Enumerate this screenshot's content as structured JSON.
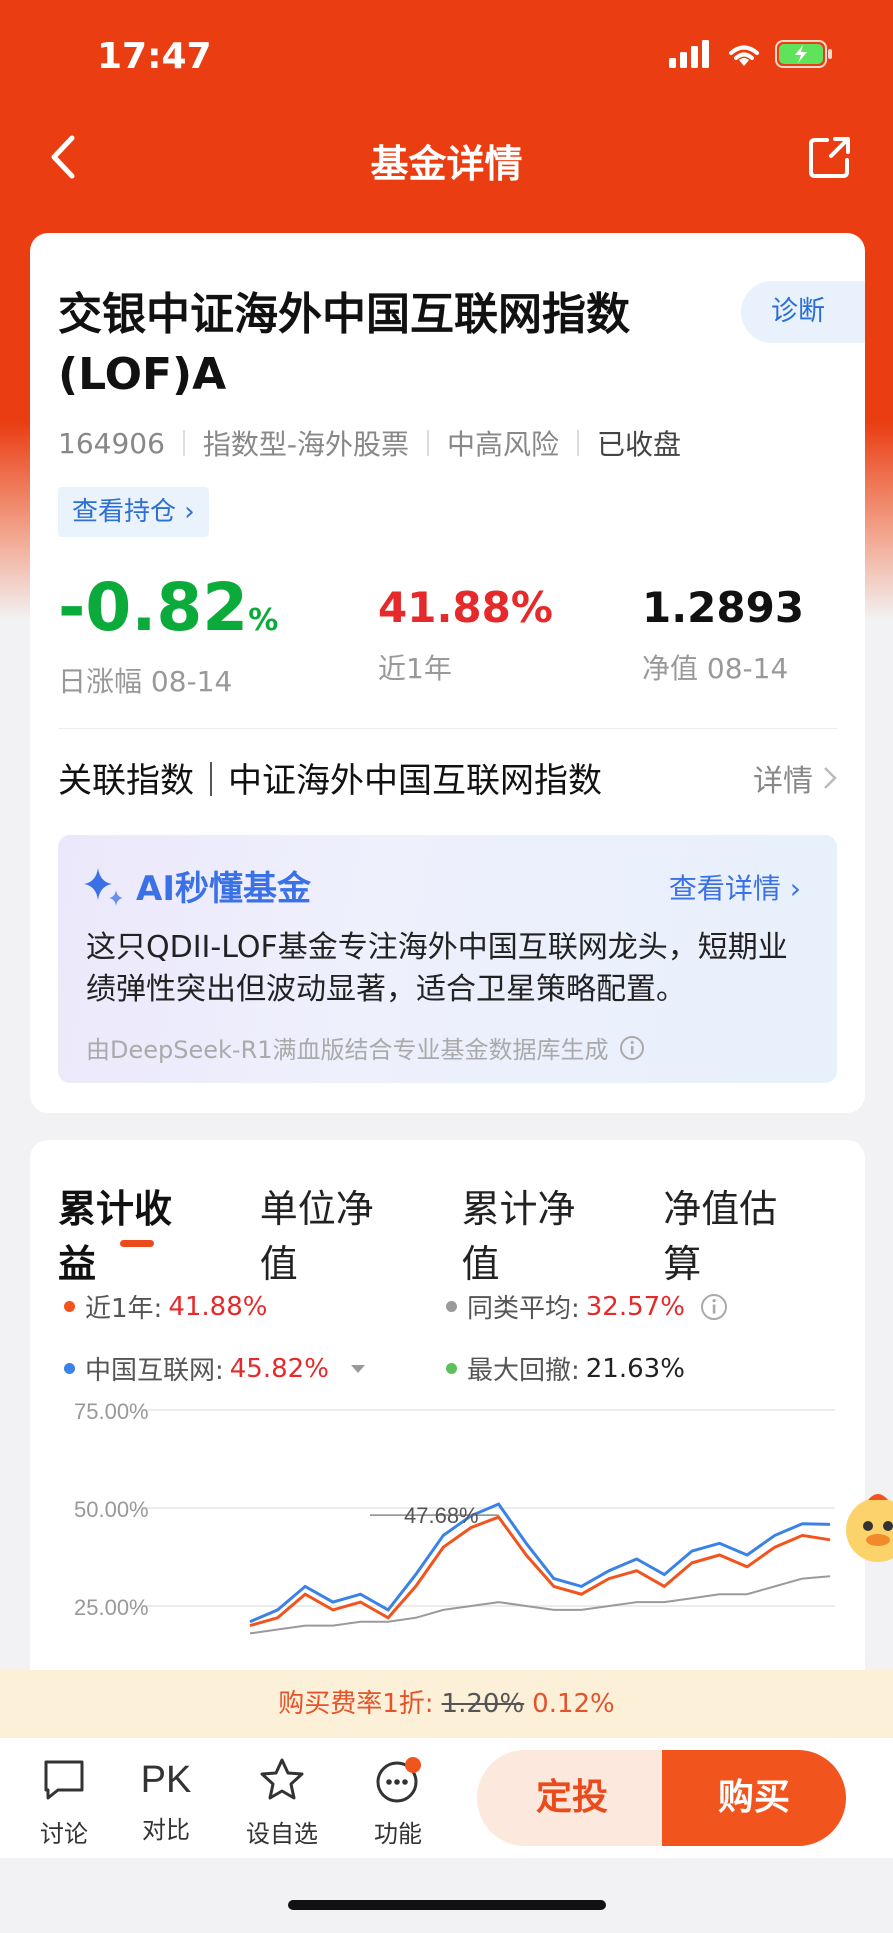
{
  "status": {
    "time": "17:47"
  },
  "nav": {
    "title": "基金详情"
  },
  "fund": {
    "name_line1": "交银中证海外中国互联网指数",
    "name_line2": "(LOF)A",
    "diagnose_label": "诊断",
    "code": "164906",
    "type": "指数型-海外股票",
    "risk": "中高风险",
    "market_status": "已收盘",
    "holdings_label": "查看持仓 ›"
  },
  "stats": {
    "daily_change": "-0.82",
    "daily_change_unit": "%",
    "daily_label": "日涨幅 08-14",
    "one_year": "41.88%",
    "one_year_label": "近1年",
    "nav": "1.2893",
    "nav_label": "净值 08-14"
  },
  "index_row": {
    "label": "关联指数｜中证海外中国互联网指数",
    "more": "详情"
  },
  "ai": {
    "title": "AI秒懂基金",
    "more": "查看详情",
    "text": "这只QDII-LOF基金专注海外中国互联网龙头，短期业绩弹性突出但波动显著，适合卫星策略配置。",
    "footer": "由DeepSeek-R1满血版结合专业基金数据库生成"
  },
  "tabs": [
    "累计收益",
    "单位净值",
    "累计净值",
    "净值估算"
  ],
  "legend": {
    "l1_name": "近1年:",
    "l1_value": "41.88%",
    "l2_name": "同类平均:",
    "l2_value": "32.57%",
    "l3_name": "中国互联网:",
    "l3_value": "45.82%",
    "l4_name": "最大回撤:",
    "l4_value": "21.63%"
  },
  "colors": {
    "fund": "#f2541d",
    "peer": "#9a9a9a",
    "index": "#3b82e6",
    "drawdown": "#5cc05c"
  },
  "chart_data": {
    "type": "line",
    "y_ticks": [
      "75.00%",
      "50.00%",
      "25.00%"
    ],
    "peak_label": "47.68%",
    "series": [
      {
        "name": "近1年",
        "values": [
          20,
          22,
          28,
          24,
          26,
          22,
          30,
          40,
          45,
          47.68,
          38,
          30,
          28,
          32,
          34,
          30,
          36,
          38,
          35,
          40,
          43,
          41.88
        ]
      },
      {
        "name": "中国互联网",
        "values": [
          21,
          24,
          30,
          26,
          28,
          24,
          33,
          43,
          48,
          51,
          41,
          32,
          30,
          34,
          37,
          33,
          39,
          41,
          38,
          43,
          46,
          45.82
        ]
      },
      {
        "name": "同类平均",
        "values": [
          18,
          19,
          20,
          20,
          21,
          21,
          22,
          24,
          25,
          26,
          25,
          24,
          24,
          25,
          26,
          26,
          27,
          28,
          28,
          30,
          32,
          32.57
        ]
      }
    ]
  },
  "fee": {
    "prefix": "购买费率1折:",
    "old": "1.20%",
    "new": "0.12%"
  },
  "bottom": {
    "discuss": "讨论",
    "compare_icon": "PK",
    "compare": "对比",
    "watch": "设自选",
    "func": "功能",
    "invest": "定投",
    "buy": "购买"
  }
}
